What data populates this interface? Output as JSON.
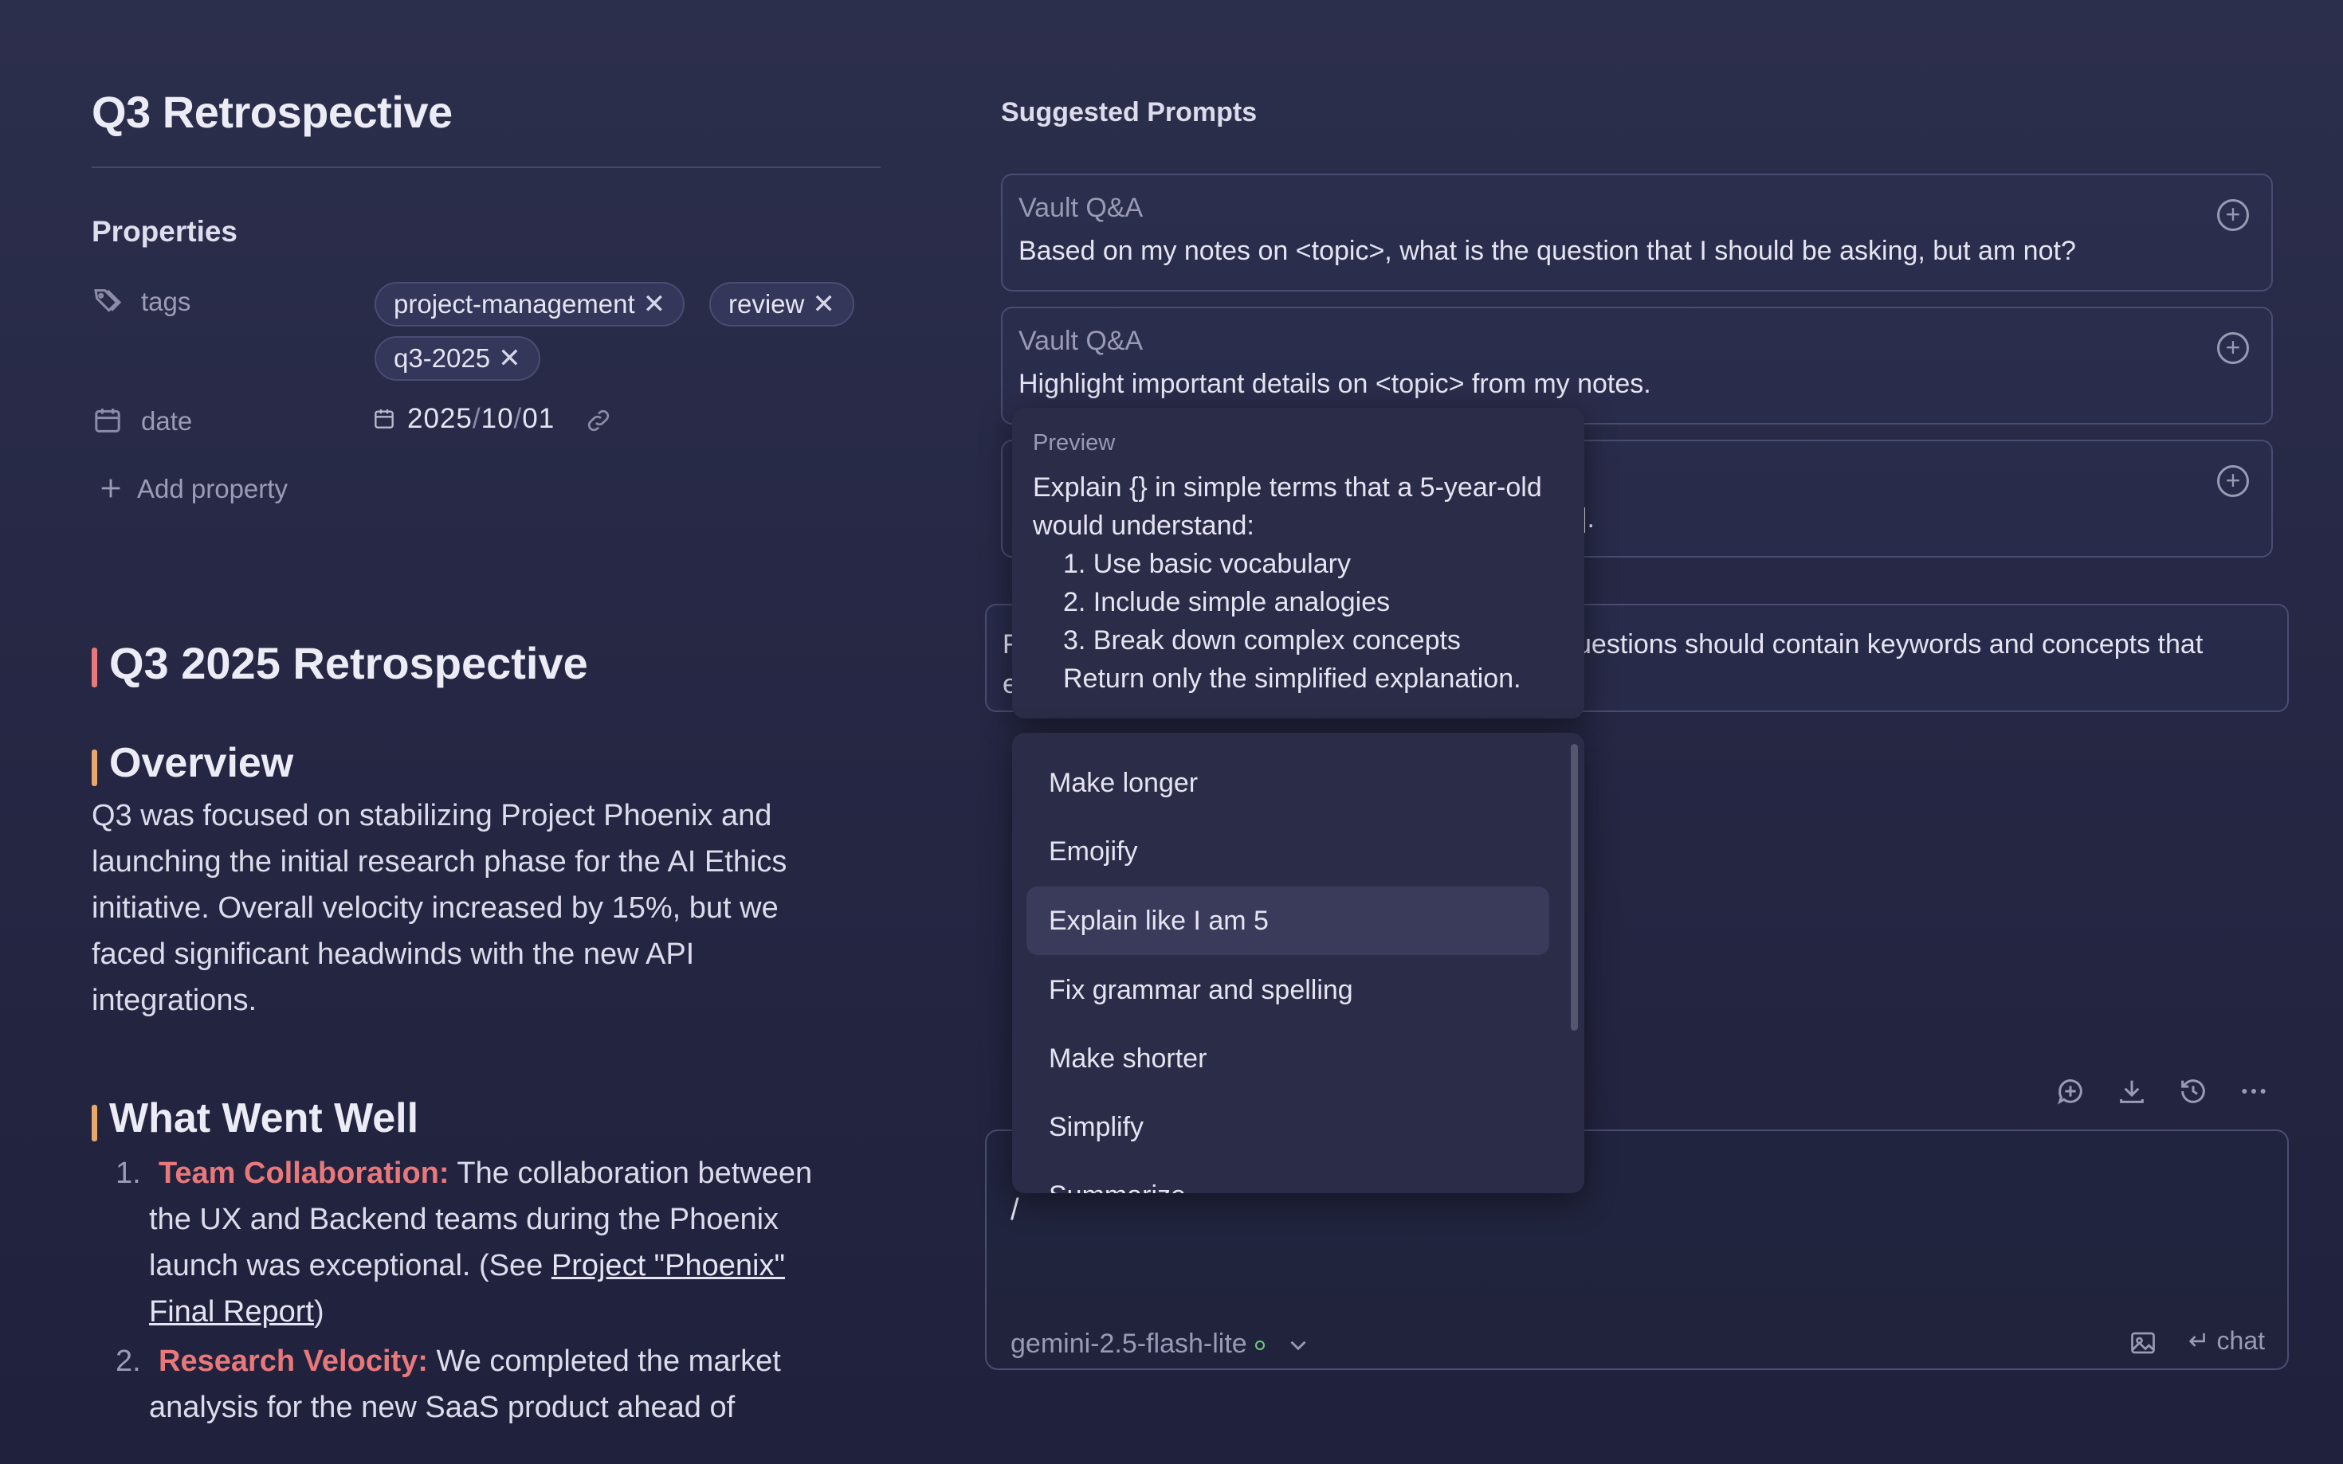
{
  "note": {
    "title": "Q3 Retrospective",
    "properties_heading": "Properties",
    "tags_label": "tags",
    "tags": [
      "project-management",
      "review",
      "q3-2025"
    ],
    "date_label": "date",
    "date_parts": [
      "2025",
      "10",
      "01"
    ],
    "date_sep": "/",
    "add_property": "Add property",
    "h1": "Q3 2025 Retrospective",
    "overview_heading": "Overview",
    "overview_text": "Q3 was focused on stabilizing Project Phoenix and launching the initial research phase for the AI Ethics initiative. Overall velocity increased by 15%, but we faced significant headwinds with the new API integrations.",
    "went_well_heading": "What Went Well",
    "items": [
      {
        "num": "1.",
        "strong": "Team Collaboration:",
        "line1": " The collaboration between",
        "line2": "the UX and Backend teams during the Phoenix",
        "line3": "launch was exceptional. (See ",
        "link1": "Project \"Phoenix\"",
        "link2": "Final Report",
        "tail": ")"
      },
      {
        "num": "2.",
        "strong": "Research Velocity:",
        "line1": " We completed the market",
        "line2": "analysis for the new SaaS product ahead of"
      }
    ]
  },
  "suggestions": {
    "heading": "Suggested Prompts",
    "cards": [
      {
        "title": "Vault Q&A",
        "body": "Based on my notes on <topic>, what is the question that I should be asking, but am not?"
      },
      {
        "title": "Vault Q&A",
        "body": "Highlight important details on <topic> from my notes."
      },
      {
        "title": "",
        "body": "]."
      }
    ],
    "prompt_fragment_1": "F",
    "prompt_fragment_2": "uestions should contain keywords and concepts that",
    "prompt_fragment_3": "e"
  },
  "preview": {
    "label": "Preview",
    "line1": "Explain {} in simple terms that a 5-year-old",
    "line2": "would understand:",
    "steps": [
      "1. Use basic vocabulary",
      "2. Include simple analogies",
      "3. Break down complex concepts"
    ],
    "closing": "Return only the simplified explanation."
  },
  "menu": {
    "items": [
      "Make longer",
      "Emojify",
      "Explain like I am 5",
      "Fix grammar and spelling",
      "Make shorter",
      "Simplify",
      "Summarize"
    ],
    "active_index": 2
  },
  "chat": {
    "input_value": "/",
    "model": "gemini-2.5-flash-lite",
    "send_label": "chat",
    "toolbar_icons": [
      "new-chat-icon",
      "download-icon",
      "history-icon",
      "more-icon"
    ]
  },
  "colors": {
    "accent_red": "#e8787a",
    "h1_bar": "#e8787a",
    "h2_bar": "#e8a86a",
    "status_green": "#6dcf7d"
  }
}
